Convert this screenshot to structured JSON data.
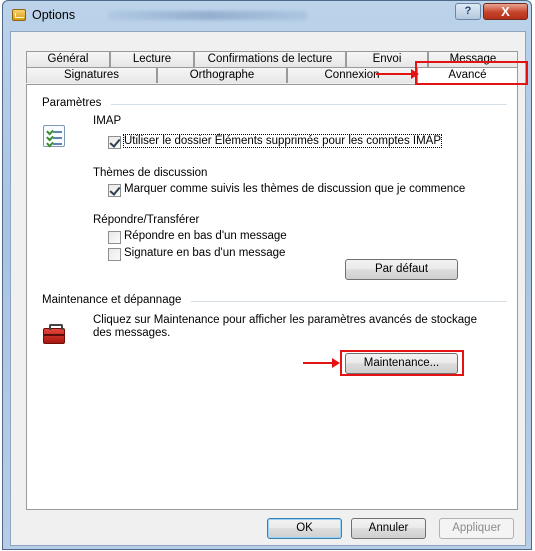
{
  "window": {
    "title": "Options"
  },
  "title_buttons": {
    "help": "?",
    "close": "X"
  },
  "tabs_row1": [
    "Général",
    "Lecture",
    "Confirmations de lecture",
    "Envoi",
    "Message"
  ],
  "tabs_row2": [
    "Signatures",
    "Orthographe",
    "Connexion",
    "Avancé"
  ],
  "parametres": {
    "title": "Paramètres",
    "imap_label": "IMAP",
    "imap_check": "Utiliser le dossier Éléments supprimés pour les comptes IMAP",
    "threads_label": "Thèmes de discussion",
    "threads_check": "Marquer comme suivis les thèmes de discussion que je commence",
    "reply_label": "Répondre/Transférer",
    "reply_bottom": "Répondre en bas d'un message",
    "signature_bottom": "Signature en bas d'un message",
    "default_button": "Par défaut"
  },
  "maintenance": {
    "title": "Maintenance et dépannage",
    "description": "Cliquez sur Maintenance pour afficher les paramètres avancés de stockage des messages.",
    "button": "Maintenance..."
  },
  "footer": {
    "ok": "OK",
    "cancel": "Annuler",
    "apply": "Appliquer"
  },
  "colors": {
    "annotation": "#e31313",
    "accent": "#3c7fb1"
  }
}
